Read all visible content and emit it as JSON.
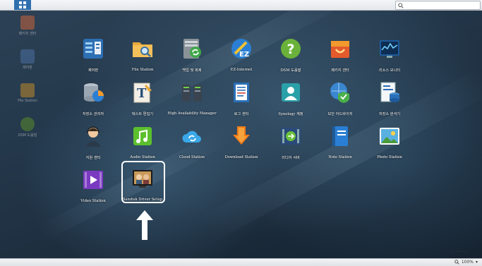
{
  "search": {
    "placeholder": ""
  },
  "desktop_icons": [
    {
      "label": "패키지 센터",
      "icon": "package-center-icon",
      "color": "#c8623a"
    },
    {
      "label": "제어판",
      "icon": "control-panel-icon",
      "color": "#4a6fa0"
    },
    {
      "label": "File Station",
      "icon": "folder-icon",
      "color": "#c08a2a"
    },
    {
      "label": "DSM 도움말",
      "icon": "help-icon",
      "color": "#5a8a2a"
    }
  ],
  "apps": [
    {
      "label": "제어판",
      "icon": "control-panel-icon"
    },
    {
      "label": "File Station",
      "icon": "folder-search-icon"
    },
    {
      "label": "백업 및 복제",
      "icon": "backup-replication-icon"
    },
    {
      "label": "EZ-Internet",
      "icon": "ez-internet-icon"
    },
    {
      "label": "DSM 도움말",
      "icon": "help-icon"
    },
    {
      "label": "패키지 센터",
      "icon": "package-center-icon"
    },
    {
      "label": "리소스 모니터",
      "icon": "resource-monitor-icon"
    },
    {
      "label": "저장소 관리자",
      "icon": "storage-manager-icon"
    },
    {
      "label": "텍스트 편집기",
      "icon": "text-editor-icon"
    },
    {
      "label": "High Availability Manager",
      "icon": "high-availability-icon"
    },
    {
      "label": "로그 센터",
      "icon": "log-center-icon"
    },
    {
      "label": "Synology 계정",
      "icon": "synology-account-icon"
    },
    {
      "label": "보안 어드바이저",
      "icon": "security-advisor-icon"
    },
    {
      "label": "저장소 분석기",
      "icon": "storage-analyzer-icon"
    },
    {
      "label": "지원 센터",
      "icon": "support-center-icon"
    },
    {
      "label": "Audio Station",
      "icon": "audio-station-icon"
    },
    {
      "label": "Cloud Station",
      "icon": "cloud-station-icon"
    },
    {
      "label": "Download Station",
      "icon": "download-station-icon"
    },
    {
      "label": "미디어 서버",
      "icon": "media-server-icon"
    },
    {
      "label": "Note Station",
      "icon": "note-station-icon"
    },
    {
      "label": "Photo Station",
      "icon": "photo-station-icon"
    },
    {
      "label": "Video Station",
      "icon": "video-station-icon"
    },
    {
      "label": "Sandisk Driver Setup",
      "icon": "driver-setup-icon"
    }
  ],
  "status": {
    "zoom": "100%"
  }
}
